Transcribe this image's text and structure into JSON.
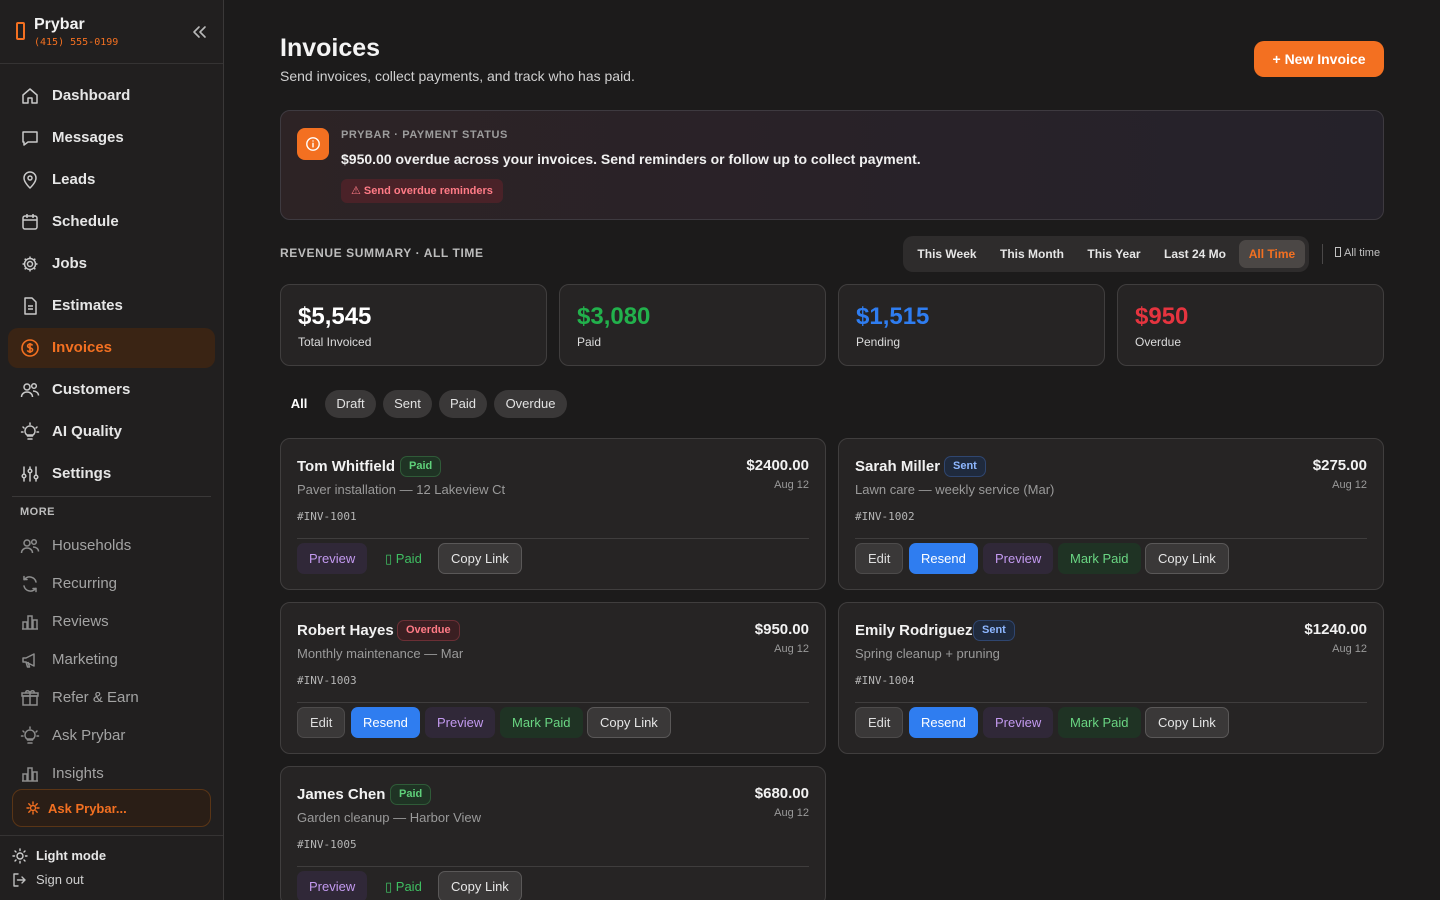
{
  "brand": {
    "name": "Prybar",
    "phone": "(415) 555-0199"
  },
  "nav": {
    "dashboard": "Dashboard",
    "messages": "Messages",
    "leads": "Leads",
    "schedule": "Schedule",
    "jobs": "Jobs",
    "estimates": "Estimates",
    "invoices": "Invoices",
    "customers": "Customers",
    "ai_quality": "AI Quality",
    "settings": "Settings"
  },
  "more": {
    "title": "MORE",
    "households": "Households",
    "recurring": "Recurring",
    "reviews": "Reviews",
    "marketing": "Marketing",
    "refer_earn": "Refer & Earn",
    "ask_prybar": "Ask Prybar",
    "insights": "Insights"
  },
  "ask_bar": {
    "label": "Ask Prybar..."
  },
  "footer": {
    "light_mode": "Light mode",
    "sign_out": "Sign out"
  },
  "header": {
    "title": "Invoices",
    "subtitle": "Send invoices, collect payments, and track who has paid.",
    "new_invoice": "+ New Invoice"
  },
  "status": {
    "kicker": "PRYBAR · PAYMENT STATUS",
    "text": "$950.00 overdue across your invoices. Send reminders or follow up to collect payment.",
    "button": "⚠ Send overdue reminders"
  },
  "revenue": {
    "title": "REVENUE SUMMARY · ALL TIME",
    "ranges": {
      "week": "This Week",
      "month": "This Month",
      "year": "This Year",
      "last24": "Last 24 Mo",
      "all": "All Time"
    },
    "all_time_label": "All time",
    "stats": {
      "total": {
        "value": "$5,545",
        "label": "Total Invoiced",
        "color": "#ffffff"
      },
      "paid": {
        "value": "$3,080",
        "label": "Paid",
        "color": "#22b14c"
      },
      "pending": {
        "value": "$1,515",
        "label": "Pending",
        "color": "#2f7df0"
      },
      "overdue": {
        "value": "$950",
        "label": "Overdue",
        "color": "#e5343f"
      }
    }
  },
  "filters": {
    "all": "All",
    "draft": "Draft",
    "sent": "Sent",
    "paid": "Paid",
    "overdue": "Overdue"
  },
  "invoices": [
    {
      "name": "Tom Whitfield",
      "status": "Paid",
      "desc": "Paver installation — 12 Lakeview Ct",
      "num": "#INV-1001",
      "amount": "$2400.00",
      "date": "Aug 12"
    },
    {
      "name": "Sarah Miller",
      "status": "Sent",
      "desc": "Lawn care — weekly service (Mar)",
      "num": "#INV-1002",
      "amount": "$275.00",
      "date": "Aug 12"
    },
    {
      "name": "Robert Hayes",
      "status": "Overdue",
      "desc": "Monthly maintenance — Mar",
      "num": "#INV-1003",
      "amount": "$950.00",
      "date": "Aug 12"
    },
    {
      "name": "Emily Rodriguez",
      "status": "Sent",
      "desc": "Spring cleanup + pruning",
      "num": "#INV-1004",
      "amount": "$1240.00",
      "date": "Aug 12"
    },
    {
      "name": "James Chen",
      "status": "Paid",
      "desc": "Garden cleanup — Harbor View",
      "num": "#INV-1005",
      "amount": "$680.00",
      "date": "Aug 12"
    }
  ],
  "actions": {
    "edit": "Edit",
    "resend": "Resend",
    "preview": "Preview",
    "mark_paid": "Mark Paid",
    "copy_link": "Copy Link",
    "paid": "Paid"
  },
  "colors": {
    "accent": "#f37021",
    "background": "#1c1b1b",
    "sidebar": "#211f1f",
    "card": "#262424"
  }
}
